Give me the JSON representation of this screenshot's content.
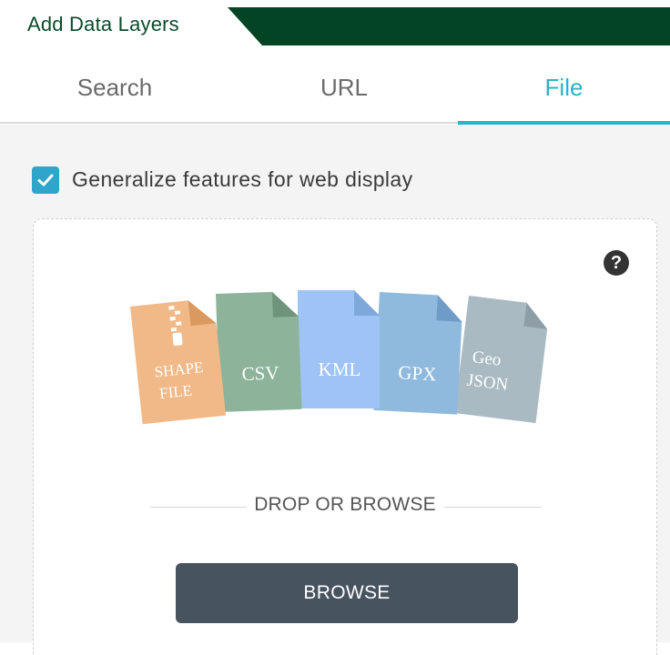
{
  "header": {
    "title": "Add Data Layers"
  },
  "tabs": [
    {
      "label": "Search"
    },
    {
      "label": "URL"
    },
    {
      "label": "File"
    }
  ],
  "active_tab": "File",
  "options": {
    "generalize_label": "Generalize features for web display",
    "generalize_checked": true
  },
  "dropzone": {
    "help_icon": "question-circle-icon",
    "file_types": [
      {
        "line1": "SHAPE",
        "line2": "FILE",
        "color": "#f1b987",
        "icon": "zip-icon"
      },
      {
        "line1": "CSV",
        "color": "#8db49a"
      },
      {
        "line1": "KML",
        "color": "#9ec4f6"
      },
      {
        "line1": "GPX",
        "color": "#8fb9dd"
      },
      {
        "line1": "Geo",
        "line2": "JSON",
        "color": "#a9bac2"
      }
    ],
    "drop_text": "DROP OR BROWSE",
    "browse_label": "BROWSE"
  },
  "colors": {
    "header_green": "#034424",
    "accent": "#26b5cc",
    "checkbox": "#2fa5cb",
    "browse_button": "#47535f"
  }
}
